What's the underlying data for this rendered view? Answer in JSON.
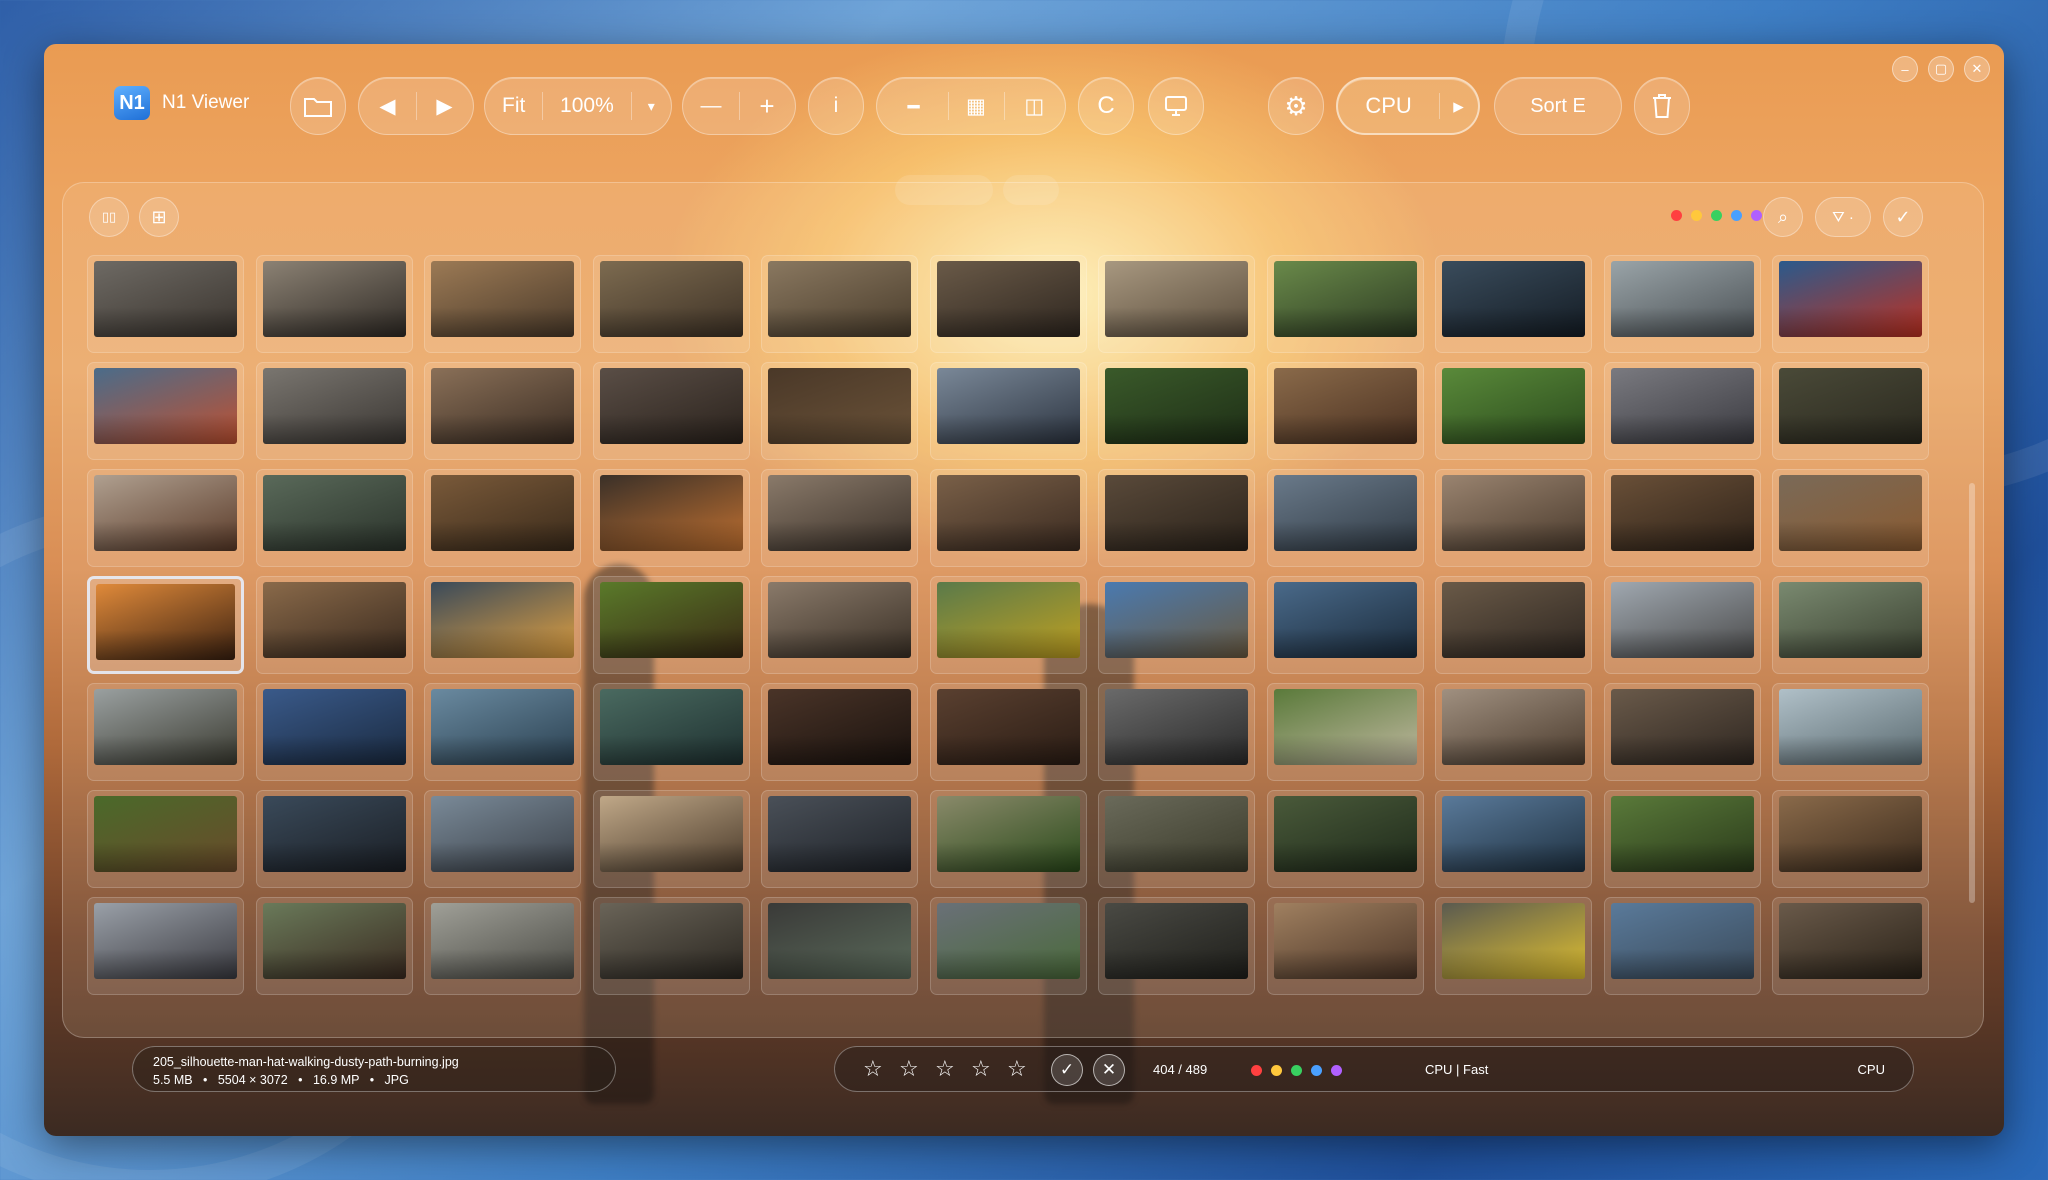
{
  "app": {
    "logo": "N1",
    "title": "N1 Viewer"
  },
  "toolbar": {
    "fit_label": "Fit",
    "zoom_value": "100%",
    "zoom_dropdown": "▾",
    "zoom_out": "—",
    "zoom_in": "+",
    "info": "i",
    "filmstrip": "▪▪▪▪",
    "grid": "▦",
    "compare": "◫",
    "c_label": "C",
    "cpu_label": "CPU",
    "cpu_arrow": "▸",
    "sort_label": "Sort E",
    "icons": {
      "folder": "folder-icon",
      "prev": "arrow-left-icon",
      "next": "arrow-right-icon",
      "monitor": "monitor-icon",
      "settings": "gear-icon",
      "trash": "trash-icon"
    }
  },
  "window_controls": {
    "minimize": "–",
    "maximize": "▢",
    "close": "✕"
  },
  "panel": {
    "view_single": "▯▯",
    "view_grid": "⊞",
    "color_dots": [
      "#ff4040",
      "#ffc83c",
      "#38d060",
      "#4aa0ff",
      "#b060ff"
    ],
    "search": "⌕",
    "filter": "⛛ ·",
    "check": "✓"
  },
  "thumbnails": [
    [
      "#6e6a64",
      "#3a342e"
    ],
    [
      "#8c8274",
      "#2f2a25"
    ],
    [
      "#9c7a55",
      "#4a3a2a"
    ],
    [
      "#7d6b50",
      "#3e3226"
    ],
    [
      "#8a7860",
      "#4a3d2c"
    ],
    [
      "#6a5a48",
      "#2e261f"
    ],
    [
      "#a89880",
      "#5b4d3c"
    ],
    [
      "#6a8a4a",
      "#2c3a22"
    ],
    [
      "#3a4c5c",
      "#141c24"
    ],
    [
      "#9aa4a8",
      "#4a5054"
    ],
    [
      "#2a5a8c",
      "#c03020"
    ],
    [
      "#4a6c8a",
      "#c05030"
    ],
    [
      "#7a7670",
      "#3a3632"
    ],
    [
      "#8a7058",
      "#3a2c22"
    ],
    [
      "#5a4e46",
      "#2a221c"
    ],
    [
      "#4a3828",
      "#6a5238"
    ],
    [
      "#7a8898",
      "#2c3440"
    ],
    [
      "#3a5a2a",
      "#1e2e16"
    ],
    [
      "#8a6a4a",
      "#4a3020"
    ],
    [
      "#5a8a3a",
      "#2a4a1c"
    ],
    [
      "#7a7a80",
      "#3a3a40"
    ],
    [
      "#4a4a38",
      "#2a281e"
    ],
    [
      "#b0a090",
      "#5a3a28"
    ],
    [
      "#5a6a5a",
      "#2a322a"
    ],
    [
      "#7a5a3a",
      "#3a2a1a"
    ],
    [
      "#3a3028",
      "#c07030"
    ],
    [
      "#8a7a6a",
      "#3a3028"
    ],
    [
      "#7a6048",
      "#3a2a20"
    ],
    [
      "#5a4a3a",
      "#2a221a"
    ],
    [
      "#6a7a8a",
      "#303a44"
    ],
    [
      "#9a8470",
      "#4a3a2c"
    ],
    [
      "#6a5038",
      "#2e2218"
    ],
    [
      "#7a6a58",
      "#8a5a30"
    ],
    [
      "#e08a3a",
      "#3a2010"
    ],
    [
      "#8a6a4a",
      "#3a2a1e"
    ],
    [
      "#3a4a5a",
      "#e0a040"
    ],
    [
      "#5a7a2a",
      "#3a2a14"
    ],
    [
      "#8a7a6a",
      "#3a3026"
    ],
    [
      "#5a7a4a",
      "#c0a020"
    ],
    [
      "#4a7ab0",
      "#6a5a40"
    ],
    [
      "#4a6a8a",
      "#1a2a3a"
    ],
    [
      "#6a5a48",
      "#2e2620"
    ],
    [
      "#a0a8b0",
      "#4a4a4a"
    ],
    [
      "#7a8a70",
      "#3a4030"
    ],
    [
      "#9aa0a0",
      "#3a3a30"
    ],
    [
      "#3a5a8a",
      "#1a2a40"
    ],
    [
      "#6a8aa0",
      "#2a4050"
    ],
    [
      "#4a6a60",
      "#1e3030"
    ],
    [
      "#4a3428",
      "#1a120e"
    ],
    [
      "#5a4030",
      "#2a1c14"
    ],
    [
      "#6a6a6a",
      "#2a2a2a"
    ],
    [
      "#5a7a3a",
      "#c0b8a0"
    ],
    [
      "#a09080",
      "#4a3a2c"
    ],
    [
      "#6a5a4a",
      "#2e2620"
    ],
    [
      "#b0c0c8",
      "#5a6a70"
    ],
    [
      "#4a6a2a",
      "#6a4a2a"
    ],
    [
      "#3a4a5a",
      "#1a1e24"
    ],
    [
      "#7a8a98",
      "#3a4048"
    ],
    [
      "#c0a888",
      "#4a3a2a"
    ],
    [
      "#4a5058",
      "#1e2228"
    ],
    [
      "#8a8a6a",
      "#2a4a1a"
    ],
    [
      "#6a6a5a",
      "#3a3a2a"
    ],
    [
      "#4a5a3a",
      "#1e2a1a"
    ],
    [
      "#5a7a9a",
      "#1e3040"
    ],
    [
      "#5a7a3a",
      "#2a3a1a"
    ],
    [
      "#8a6a4a",
      "#3a2a1c"
    ],
    [
      "#9aa0a8",
      "#3a3a40"
    ],
    [
      "#6a7a5a",
      "#3a2a20"
    ],
    [
      "#a0a098",
      "#4a4a44"
    ],
    [
      "#6a6458",
      "#2a2620"
    ],
    [
      "#3a3a38",
      "#5a6a5a"
    ],
    [
      "#6a7078",
      "#4a6a3a"
    ],
    [
      "#4a4a44",
      "#1e1e1a"
    ],
    [
      "#a08060",
      "#4a3426"
    ],
    [
      "#5a5a50",
      "#e0c030"
    ],
    [
      "#5a7a9a",
      "#3a4a5a"
    ],
    [
      "#6a5a4a",
      "#2a2218"
    ]
  ],
  "info_bar": {
    "filename": "205_silhouette-man-hat-walking-dusty-path-burning.jpg",
    "size": "5.5 MB",
    "dimensions": "5504 × 3072",
    "megapixels": "16.9 MP",
    "format": "JPG",
    "sep": "•"
  },
  "status_bar": {
    "star": "☆",
    "accept": "✓",
    "reject": "✕",
    "position": "404 / 489",
    "color_dots": [
      "#ff4040",
      "#ffc83c",
      "#38d060",
      "#4aa0ff",
      "#b060ff"
    ],
    "mode": "CPU | Fast",
    "engine": "CPU"
  }
}
